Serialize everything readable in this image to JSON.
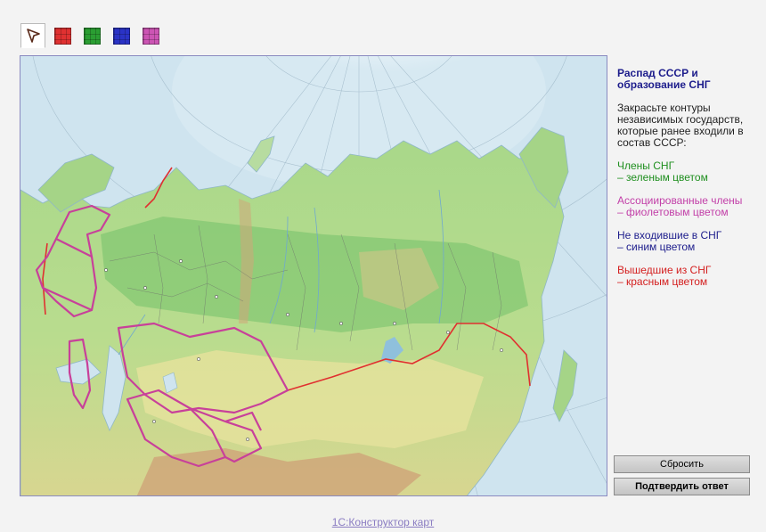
{
  "toolbar": {
    "tools": [
      {
        "name": "pointer-tool",
        "icon": "arrow-pointer-icon",
        "selected": true
      },
      {
        "name": "red-fill-tool",
        "color": "#e03131"
      },
      {
        "name": "green-fill-tool",
        "color": "#2a9e32"
      },
      {
        "name": "blue-fill-tool",
        "color": "#2a33c6"
      },
      {
        "name": "violet-fill-tool",
        "color": "#cc55b4"
      }
    ]
  },
  "map": {
    "colors": {
      "sea": "#cfe4ef",
      "lowland": "#9fd27f",
      "forest": "#6fbe6a",
      "upland": "#e6e29c",
      "mountain": "#cfa77a",
      "ice": "#f5fbff",
      "associated_border": "#c8409a",
      "withdrawn_border": "#e03030"
    }
  },
  "panel": {
    "title": "Распад СССР и образование СНГ",
    "description": "Закрасьте контуры независимых государств, которые ранее входили в состав СССР:",
    "legend": [
      {
        "line1": "Члены СНГ",
        "line2": "– зеленым цветом",
        "color": "#1f8f1f"
      },
      {
        "line1": "Ассоциированные члены",
        "line2": "– фиолетовым цветом",
        "color": "#c23fa8"
      },
      {
        "line1": "Не входившие в СНГ",
        "line2": "– синим цветом",
        "color": "#1d1d8c"
      },
      {
        "line1": "Вышедшие из СНГ",
        "line2": "– красным цветом",
        "color": "#d42020"
      }
    ]
  },
  "buttons": {
    "reset": "Сбросить",
    "confirm": "Подтвердить ответ"
  },
  "footer": {
    "link": "1С:Конструктор карт"
  }
}
